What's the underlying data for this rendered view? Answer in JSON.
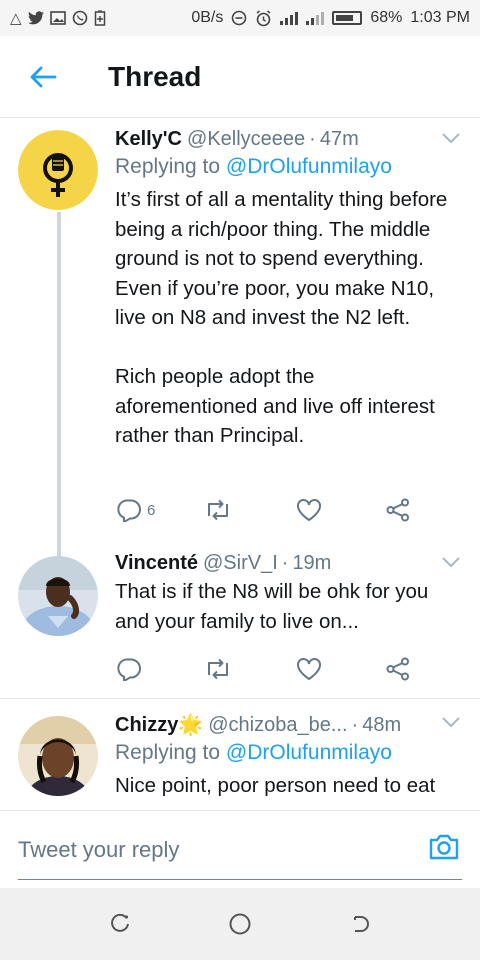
{
  "status_bar": {
    "net_speed": "0B/s",
    "battery_percent": "68%",
    "time": "1:03 PM"
  },
  "app_bar": {
    "title": "Thread"
  },
  "tweets": [
    {
      "name": "Kelly'C",
      "handle": "@Kellyceeee",
      "time": "47m",
      "replying_prefix": "Replying to",
      "replying_to": "@DrOlufunmilayo",
      "body_p1": "It’s first of all a mentality thing before being a rich/poor thing. The middle ground is not to spend everything. Even if you’re poor, you make N10, live on N8 and invest the N2 left.",
      "body_p2": "Rich people adopt the aforementioned and live off interest rather than Principal.",
      "reply_count": "6",
      "avatar_color": "#f5d547"
    },
    {
      "name": "Vincenté",
      "handle": "@SirV_I",
      "time": "19m",
      "body": "That is if the N8 will be ohk for you and your family to live on..."
    },
    {
      "name": "Chizzy🌟",
      "handle": "@chizoba_be...",
      "time": "48m",
      "replying_prefix": "Replying to",
      "replying_to": "@DrOlufunmilayo",
      "body": "Nice point, poor person need to eat"
    }
  ],
  "reply_bar": {
    "placeholder": "Tweet your reply"
  },
  "colors": {
    "accent": "#1da1f2",
    "muted": "#657786",
    "divider": "#e1e8ed"
  }
}
